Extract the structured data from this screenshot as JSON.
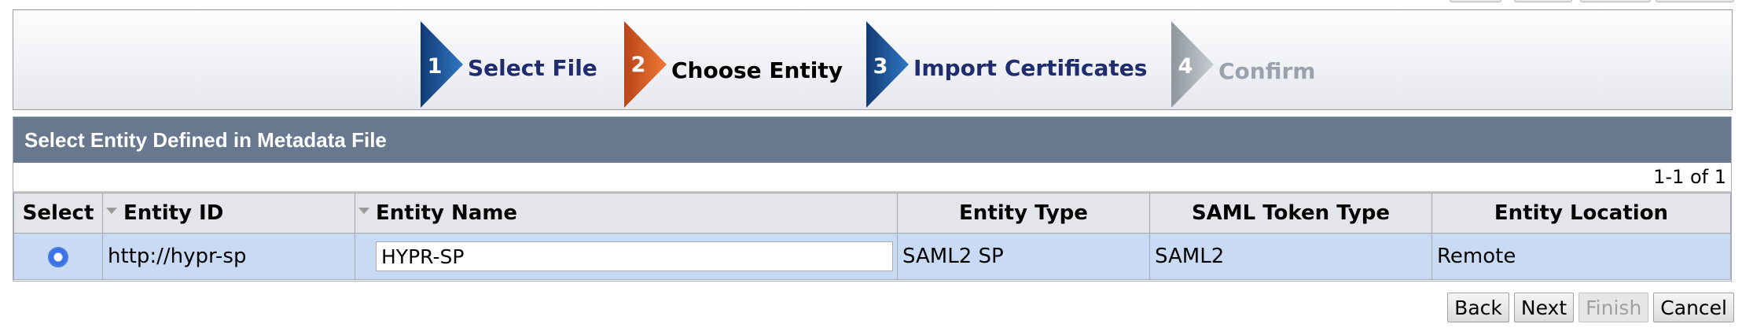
{
  "wizard": {
    "steps": [
      {
        "number": "1",
        "label": "Select File",
        "state": "done",
        "color": "#1f5f9e"
      },
      {
        "number": "2",
        "label": "Choose Entity",
        "state": "current",
        "color": "#e06a28"
      },
      {
        "number": "3",
        "label": "Import Certificates",
        "state": "done",
        "color": "#1f5f9e"
      },
      {
        "number": "4",
        "label": "Confirm",
        "state": "disabled",
        "color": "#a9b0b7"
      }
    ]
  },
  "panel": {
    "title": "Select Entity Defined in Metadata File",
    "pager": "1-1 of 1"
  },
  "table": {
    "columns": {
      "select": "Select",
      "entity_id": "Entity ID",
      "entity_name": "Entity Name",
      "entity_type": "Entity Type",
      "saml_token_type": "SAML Token Type",
      "entity_location": "Entity Location"
    },
    "rows": [
      {
        "selected": true,
        "entity_id": "http://hypr-sp",
        "entity_name": "HYPR-SP",
        "entity_type": "SAML2 SP",
        "saml_token_type": "SAML2",
        "entity_location": "Remote"
      }
    ]
  },
  "buttons": {
    "back": "Back",
    "next": "Next",
    "finish": "Finish",
    "cancel": "Cancel"
  },
  "colors": {
    "header_bar": "#67788f",
    "row_selected": "#c9dbf4",
    "step_done_text": "#1f2c6e"
  }
}
